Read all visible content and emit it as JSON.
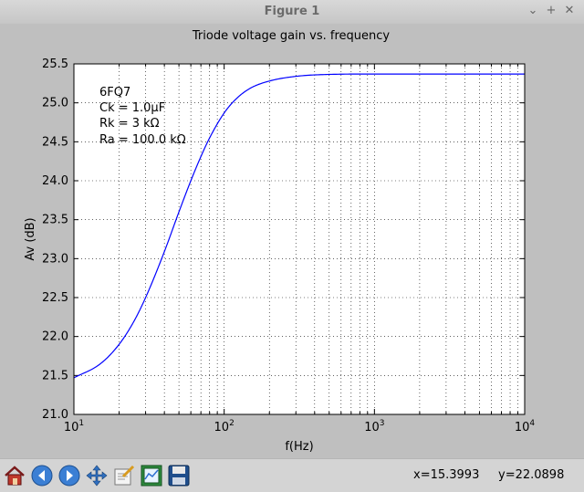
{
  "window": {
    "title": "Figure 1",
    "controls": [
      "⌄",
      "+",
      "✕"
    ]
  },
  "chart_data": {
    "type": "line",
    "title": "Triode voltage gain vs. frequency",
    "xlabel": "f(Hz)",
    "ylabel": "Av (dB)",
    "xscale": "log",
    "xlim": [
      10,
      10000
    ],
    "ylim": [
      21.0,
      25.5
    ],
    "grid": true,
    "yticks": [
      "21.0",
      "21.5",
      "22.0",
      "22.5",
      "23.0",
      "23.5",
      "24.0",
      "24.5",
      "25.0",
      "25.5"
    ],
    "xticks": [
      {
        "base": "10",
        "exp": "1"
      },
      {
        "base": "10",
        "exp": "2"
      },
      {
        "base": "10",
        "exp": "3"
      },
      {
        "base": "10",
        "exp": "4"
      }
    ],
    "annotations": [
      "6FQ7",
      "Ck = 1.0μF",
      "Rk = 3 kΩ",
      "Ra = 100.0 kΩ"
    ],
    "series": [
      {
        "color": "#0000ff",
        "x": [
          10,
          15,
          20,
          25,
          30,
          40,
          50,
          60,
          70,
          80,
          100,
          120,
          150,
          200,
          300,
          500,
          1000,
          2000,
          5000,
          10000
        ],
        "y": [
          21.47,
          21.65,
          21.9,
          22.19,
          22.5,
          23.09,
          23.6,
          24.0,
          24.31,
          24.55,
          24.87,
          25.05,
          25.19,
          25.28,
          25.34,
          25.365,
          25.37,
          25.37,
          25.37,
          25.37
        ]
      }
    ]
  },
  "toolbar": {
    "buttons": [
      {
        "name": "home-icon"
      },
      {
        "name": "back-icon"
      },
      {
        "name": "forward-icon"
      },
      {
        "name": "pan-icon"
      },
      {
        "name": "zoom-icon"
      },
      {
        "name": "subplots-icon"
      },
      {
        "name": "save-icon"
      }
    ],
    "x_readout": "x=15.3993",
    "y_readout": "y=22.0898"
  },
  "colors": {
    "background": "#bfbfbf",
    "axes": "#ffffff",
    "line": "#0000ff"
  }
}
